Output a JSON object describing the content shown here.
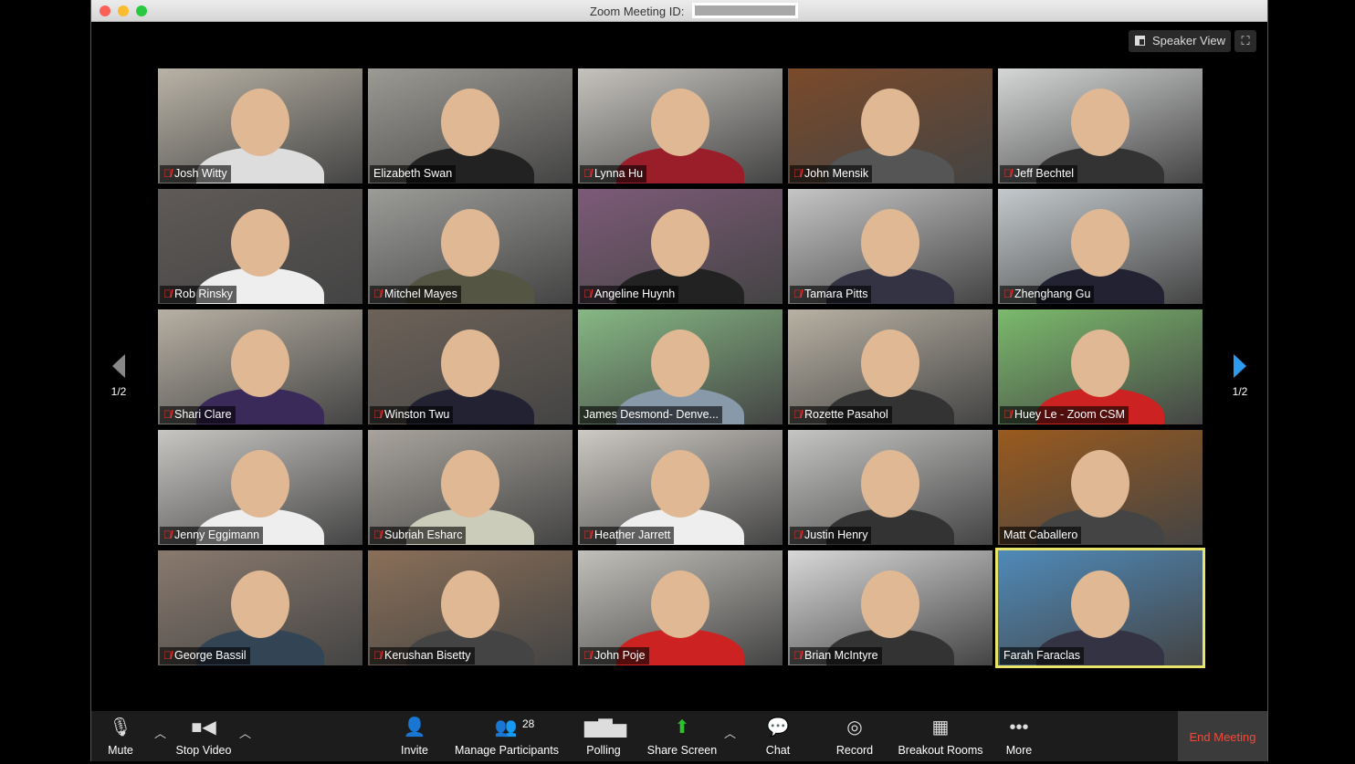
{
  "window": {
    "title": "Zoom Meeting ID:",
    "speaker_view": "Speaker View"
  },
  "pagination": {
    "left": "1/2",
    "right": "1/2"
  },
  "participants": [
    {
      "name": "Josh Witty",
      "muted": true
    },
    {
      "name": "Elizabeth Swan",
      "muted": false
    },
    {
      "name": "Lynna Hu",
      "muted": true
    },
    {
      "name": "John Mensik",
      "muted": true
    },
    {
      "name": "Jeff Bechtel",
      "muted": true
    },
    {
      "name": "Rob Rinsky",
      "muted": true
    },
    {
      "name": "Mitchel Mayes",
      "muted": true
    },
    {
      "name": "Angeline Huynh",
      "muted": true
    },
    {
      "name": "Tamara Pitts",
      "muted": true
    },
    {
      "name": "Zhenghang Gu",
      "muted": true
    },
    {
      "name": "Shari Clare",
      "muted": true
    },
    {
      "name": "Winston Twu",
      "muted": true
    },
    {
      "name": "James Desmond- Denve...",
      "muted": false
    },
    {
      "name": "Rozette Pasahol",
      "muted": true
    },
    {
      "name": "Huey Le - Zoom CSM",
      "muted": true
    },
    {
      "name": "Jenny Eggimann",
      "muted": true
    },
    {
      "name": "Subriah Esharc",
      "muted": true
    },
    {
      "name": "Heather Jarrett",
      "muted": true
    },
    {
      "name": "Justin Henry",
      "muted": true
    },
    {
      "name": "Matt Caballero",
      "muted": false
    },
    {
      "name": "George Bassil",
      "muted": true
    },
    {
      "name": "Kerushan Bisetty",
      "muted": true
    },
    {
      "name": "John Poje",
      "muted": true
    },
    {
      "name": "Brian McIntyre",
      "muted": true
    },
    {
      "name": "Farah Faraclas",
      "muted": false,
      "active_speaker": true
    }
  ],
  "toolbar": {
    "mute": "Mute",
    "stop_video": "Stop Video",
    "invite": "Invite",
    "manage_participants": "Manage Participants",
    "participant_count": "28",
    "polling": "Polling",
    "share_screen": "Share Screen",
    "chat": "Chat",
    "record": "Record",
    "breakout_rooms": "Breakout Rooms",
    "more": "More",
    "end_meeting": "End Meeting"
  },
  "colors": {
    "share_green": "#2fbf2f",
    "end_red": "#f04a3b",
    "active_border": "#e8e56a",
    "nav_arrow": "#2d9bf0"
  }
}
